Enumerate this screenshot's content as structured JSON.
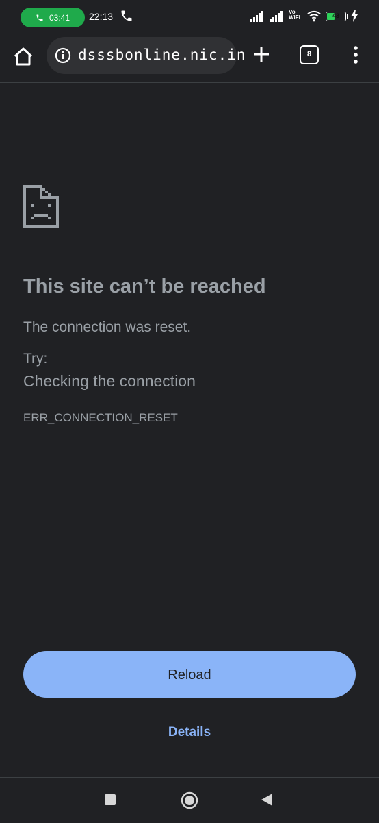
{
  "status_bar": {
    "call_duration": "03:41",
    "time": "22:13",
    "network_label_top": "Vo",
    "network_label_bottom": "WiFi",
    "battery_percent": "43",
    "battery_level": 0.43
  },
  "toolbar": {
    "url": "dsssbonline.nic.in",
    "tab_count": "8"
  },
  "error": {
    "title": "This site can’t be reached",
    "description": "The connection was reset.",
    "try_label": "Try:",
    "suggestion": "Checking the connection",
    "code": "ERR_CONNECTION_RESET"
  },
  "actions": {
    "reload_label": "Reload",
    "details_label": "Details"
  },
  "colors": {
    "background": "#202124",
    "accent": "#8ab4f8",
    "text_secondary": "#9aa0a6",
    "call_pill": "#1faa4b"
  }
}
